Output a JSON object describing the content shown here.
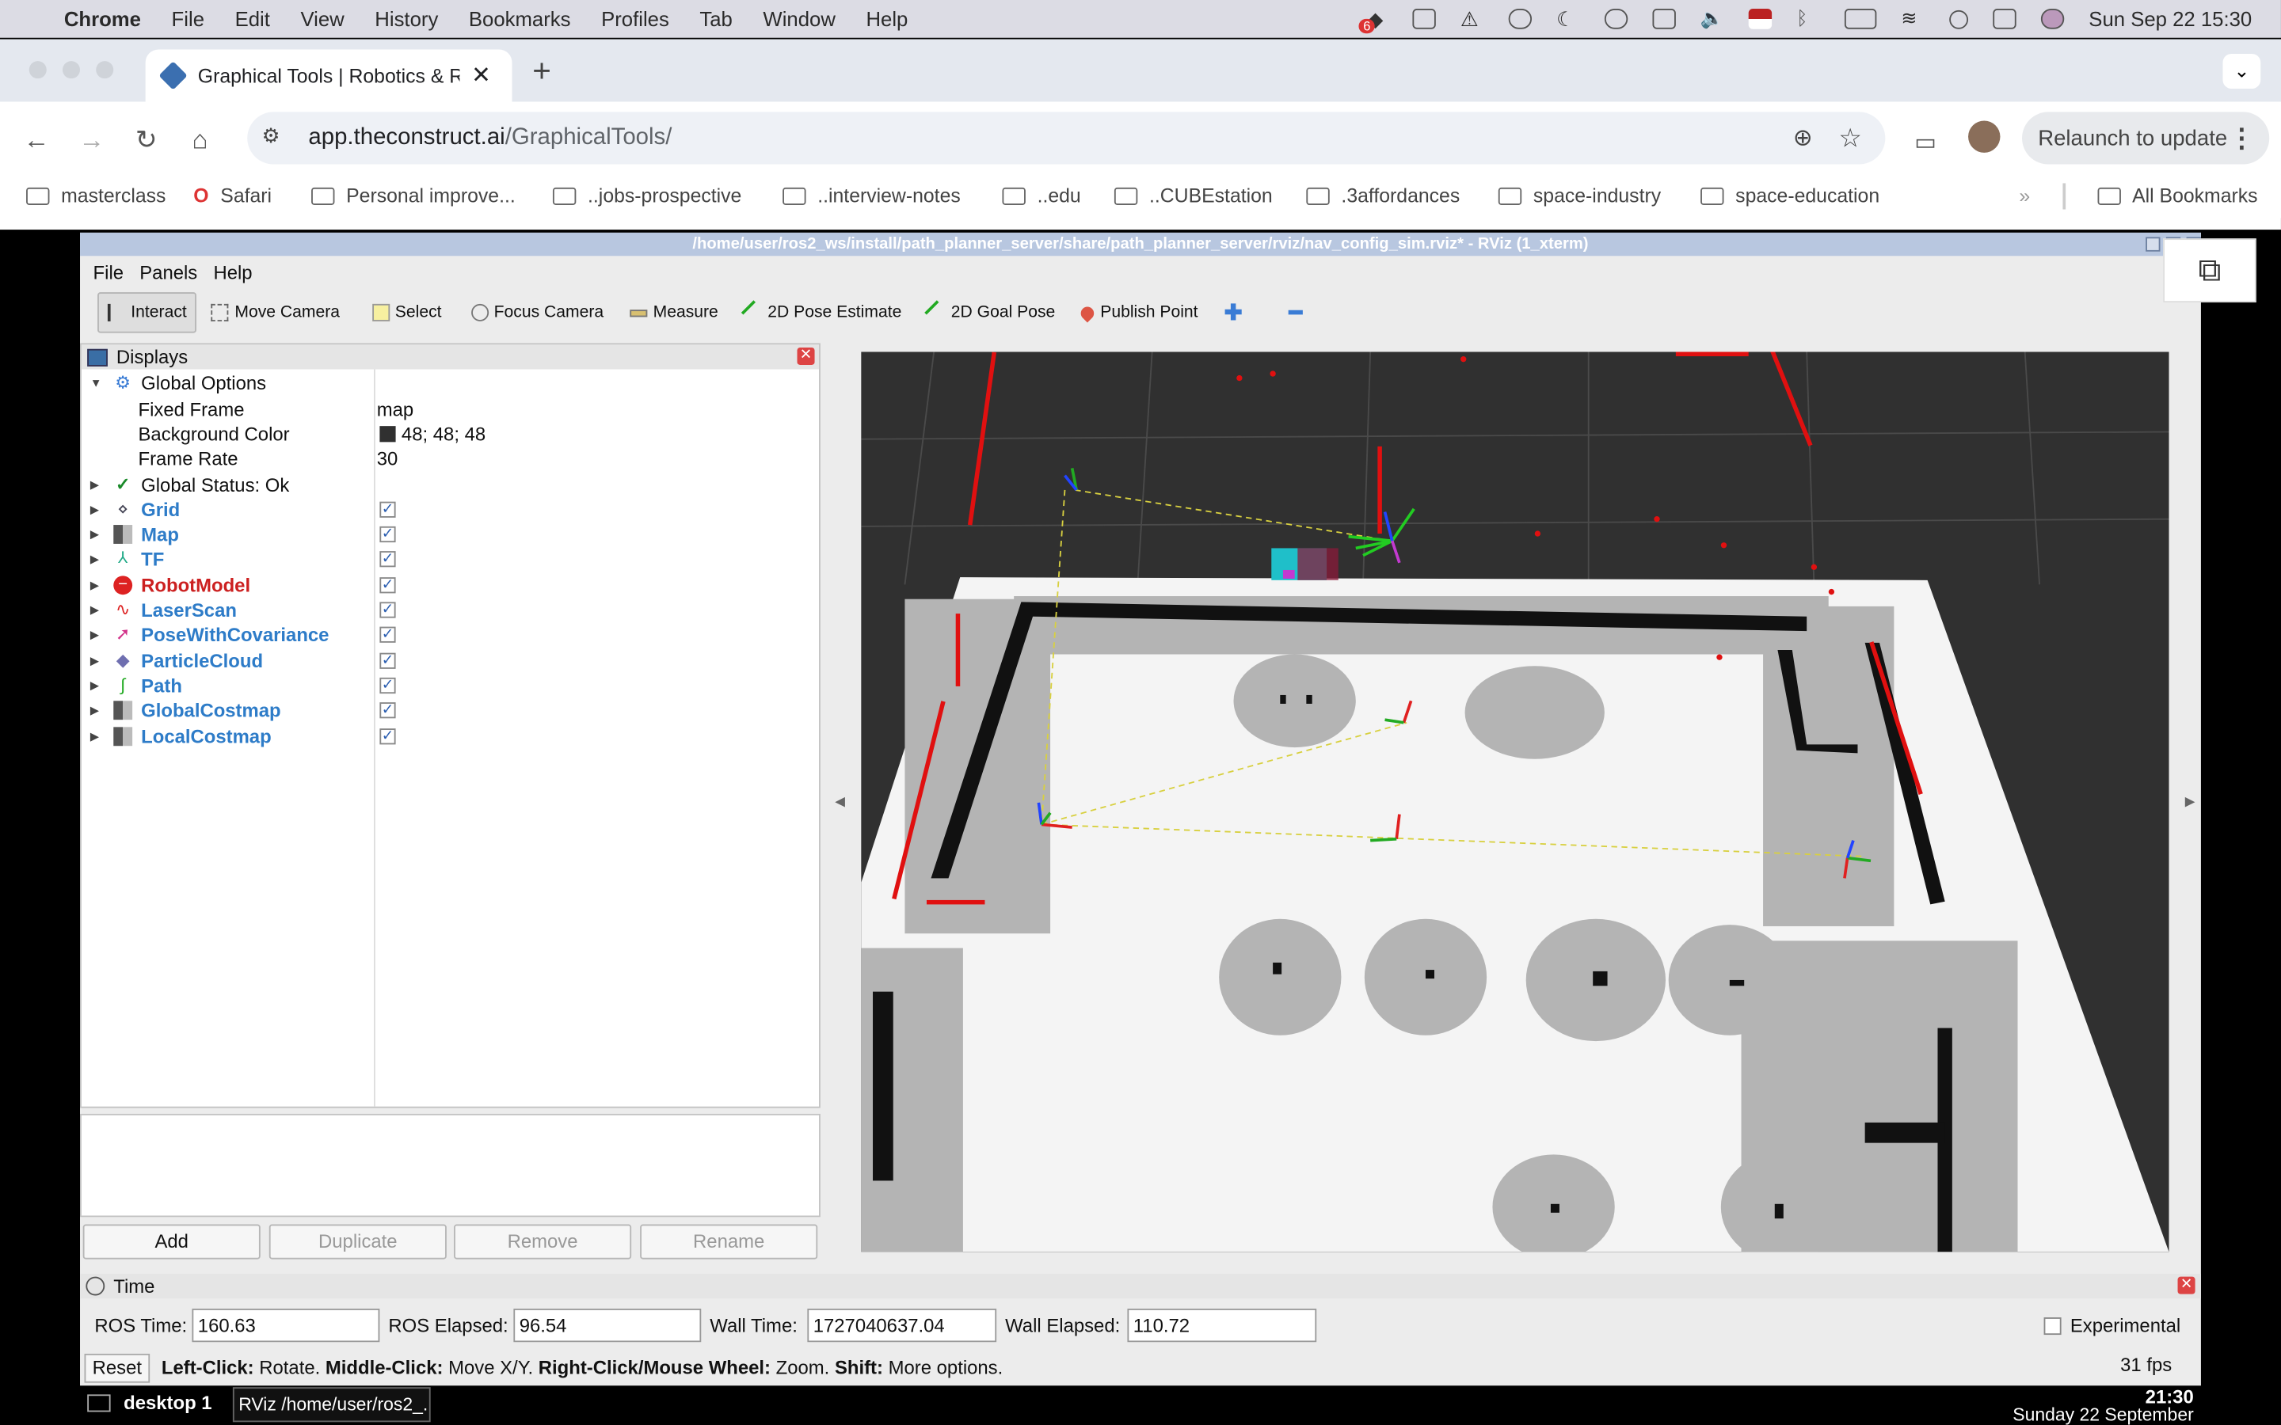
{
  "mac_menubar": {
    "app": "Chrome",
    "items": [
      "File",
      "Edit",
      "View",
      "History",
      "Bookmarks",
      "Profiles",
      "Tab",
      "Window",
      "Help"
    ],
    "clock": "Sun Sep 22  15:30",
    "badge": "6"
  },
  "chrome": {
    "tab_title": "Graphical Tools | Robotics & R",
    "url_host": "app.theconstruct.ai",
    "url_path": "/GraphicalTools/",
    "relaunch_label": "Relaunch to update",
    "bookmarks": [
      "masterclass",
      "Safari",
      "Personal improve...",
      "..jobs-prospective",
      "..interview-notes",
      "..edu",
      "..CUBEstation",
      ".3affordances",
      "space-industry",
      "space-education"
    ],
    "all_bookmarks": "All Bookmarks"
  },
  "rviz": {
    "title": "/home/user/ros2_ws/install/path_planner_server/share/path_planner_server/rviz/nav_config_sim.rviz* - RViz (1_xterm)",
    "menu": [
      "File",
      "Panels",
      "Help"
    ],
    "tools": [
      "Interact",
      "Move Camera",
      "Select",
      "Focus Camera",
      "Measure",
      "2D Pose Estimate",
      "2D Goal Pose",
      "Publish Point"
    ],
    "displays_title": "Displays",
    "global_options": {
      "label": "Global Options",
      "fixed_frame_label": "Fixed Frame",
      "fixed_frame": "map",
      "bg_color_label": "Background Color",
      "bg_color": "48; 48; 48",
      "bg_swatch": "#303030",
      "frame_rate_label": "Frame Rate",
      "frame_rate": "30"
    },
    "global_status": "Global Status: Ok",
    "displays": [
      {
        "name": "Grid",
        "icon": "grid-icon",
        "color": "#2e7cc8"
      },
      {
        "name": "Map",
        "icon": "map-icon",
        "color": "#2e7cc8"
      },
      {
        "name": "TF",
        "icon": "tf-icon",
        "color": "#2e7cc8"
      },
      {
        "name": "RobotModel",
        "icon": "error-icon",
        "color": "#cc2020"
      },
      {
        "name": "LaserScan",
        "icon": "laserscan-icon",
        "color": "#2e7cc8"
      },
      {
        "name": "PoseWithCovariance",
        "icon": "pose-icon",
        "color": "#2e7cc8"
      },
      {
        "name": "ParticleCloud",
        "icon": "particle-icon",
        "color": "#2e7cc8"
      },
      {
        "name": "Path",
        "icon": "path-icon",
        "color": "#2e7cc8"
      },
      {
        "name": "GlobalCostmap",
        "icon": "costmap-icon",
        "color": "#2e7cc8"
      },
      {
        "name": "LocalCostmap",
        "icon": "costmap-icon",
        "color": "#2e7cc8"
      }
    ],
    "buttons": {
      "add": "Add",
      "duplicate": "Duplicate",
      "remove": "Remove",
      "rename": "Rename"
    },
    "time_title": "Time",
    "time": {
      "ros_time_label": "ROS Time:",
      "ros_time": "160.63",
      "ros_elapsed_label": "ROS Elapsed:",
      "ros_elapsed": "96.54",
      "wall_time_label": "Wall Time:",
      "wall_time": "1727040637.04",
      "wall_elapsed_label": "Wall Elapsed:",
      "wall_elapsed": "110.72",
      "experimental_label": "Experimental"
    },
    "reset_label": "Reset",
    "hint": {
      "left": "Left-Click:",
      "left_t": " Rotate. ",
      "middle": "Middle-Click:",
      "middle_t": " Move X/Y. ",
      "right": "Right-Click/Mouse Wheel:",
      "right_t": " Zoom. ",
      "shift": "Shift:",
      "shift_t": " More options."
    },
    "fps": "31 fps"
  },
  "taskbar": {
    "desktop": "desktop 1",
    "task": "RViz /home/user/ros2_...",
    "time": "21:30",
    "date": "Sunday 22 September"
  }
}
